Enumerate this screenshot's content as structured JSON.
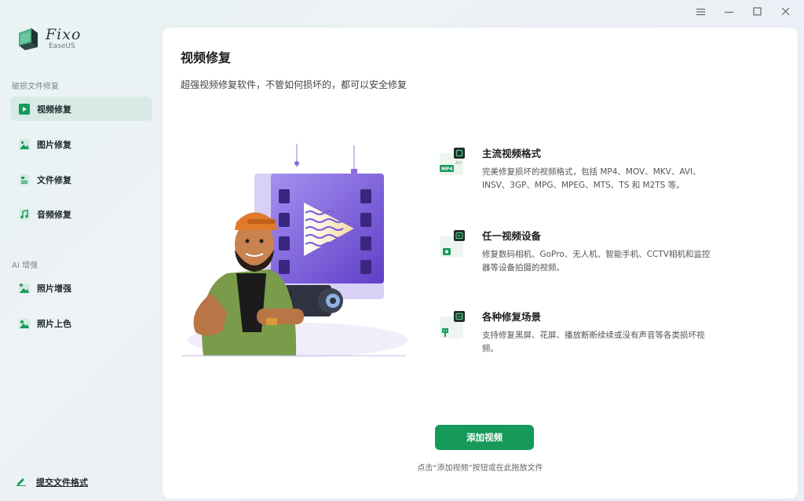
{
  "app": {
    "name": "Fixo",
    "brand": "EaseUS"
  },
  "window_controls": [
    {
      "name": "menu-icon"
    },
    {
      "name": "minimize-icon"
    },
    {
      "name": "maximize-icon"
    },
    {
      "name": "close-icon"
    }
  ],
  "sidebar": {
    "section1_title": "破损文件修复",
    "items": [
      {
        "label": "视频修复",
        "icon": "video-play-icon",
        "active": true
      },
      {
        "label": "图片修复",
        "icon": "image-icon"
      },
      {
        "label": "文件修复",
        "icon": "document-icon"
      },
      {
        "label": "音频修复",
        "icon": "music-icon"
      }
    ],
    "section2_title": "AI 增强",
    "ai_items": [
      {
        "label": "照片增强",
        "icon": "photo-enhance-icon"
      },
      {
        "label": "照片上色",
        "icon": "photo-colorize-icon"
      }
    ],
    "submit_format": "提交文件格式"
  },
  "main": {
    "title": "视频修复",
    "subtitle": "超强视频修复软件，不管如何损坏的，都可以安全修复",
    "features": [
      {
        "title": "主流视频格式",
        "desc": "完美修复损坏的视频格式，包括 MP4、MOV、MKV、AVI、INSV、3GP、MPG、MPEG、MTS、TS 和 M2TS 等。",
        "icon_labels": [
          "MP4",
          "AVI"
        ]
      },
      {
        "title": "任一视频设备",
        "desc": "修复数码相机、GoPro、无人机、智能手机、CCTV相机和监控器等设备拍摄的视频。"
      },
      {
        "title": "各种修复场景",
        "desc": "支持修复黑屏、花屏、播放断断续续或没有声音等各类损坏视频。"
      }
    ],
    "add_button": "添加视频",
    "hint": "点击“添加视频”按钮或在此拖放文件"
  },
  "colors": {
    "accent": "#169a5a",
    "active_bg": "#d8eae6",
    "purple": "#7b5cd6"
  }
}
